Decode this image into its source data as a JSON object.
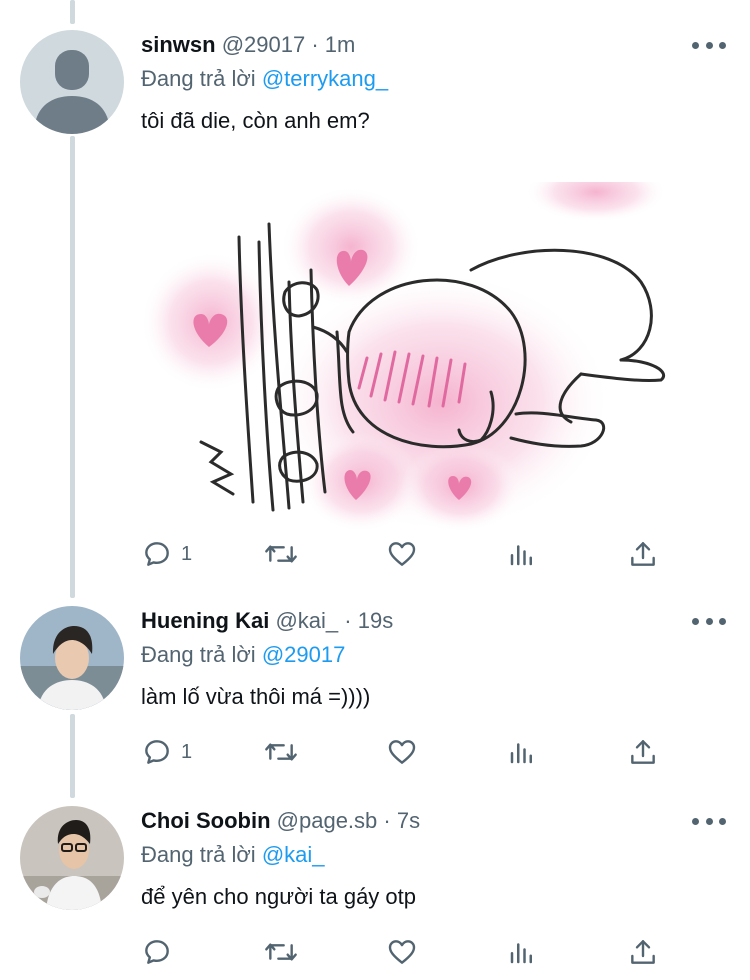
{
  "tweets": [
    {
      "name": "sinwsn",
      "handle": "@29017",
      "time": "1m",
      "replying_label": "Đang trả lời",
      "replying_to": "@terrykang_",
      "text": "tôi đã die, còn anh em?",
      "reply_count": "1",
      "has_media": true,
      "avatar": "default-avatar"
    },
    {
      "name": "Huening Kai",
      "handle": "@kai_",
      "time": "19s",
      "replying_label": "Đang trả lời",
      "replying_to": "@29017",
      "text": "làm lố vừa thôi má =))))",
      "reply_count": "1",
      "has_media": false,
      "avatar": "photo-avatar"
    },
    {
      "name": "Choi Soobin",
      "handle": "@page.sb",
      "time": "7s",
      "replying_label": "Đang trả lời",
      "replying_to": "@kai_",
      "text": "để yên cho người ta gáy otp",
      "reply_count": "",
      "has_media": false,
      "avatar": "photo-avatar"
    }
  ],
  "separator": " · ",
  "action_icons": [
    "reply-icon",
    "retweet-icon",
    "like-icon",
    "analytics-icon",
    "share-icon"
  ],
  "colors": {
    "mention": "#1d9bf0",
    "secondary": "#536471",
    "thread_line": "#cfd9de",
    "heart_pink": "#e87aa8"
  }
}
